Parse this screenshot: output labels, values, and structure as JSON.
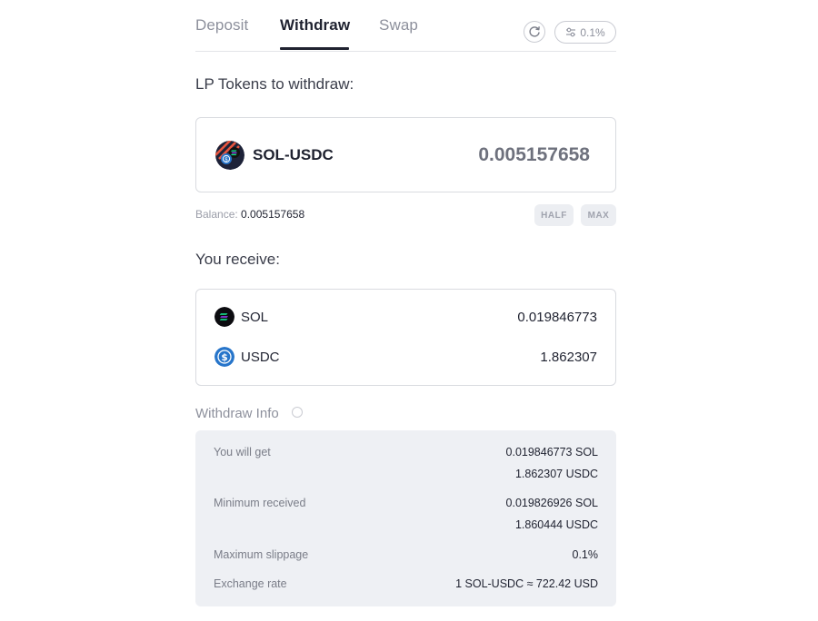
{
  "tabs": [
    {
      "label": "Deposit",
      "active": false
    },
    {
      "label": "Withdraw",
      "active": true
    },
    {
      "label": "Swap",
      "active": false
    }
  ],
  "slippage_button": "0.1%",
  "lp_section_label": "LP Tokens to withdraw:",
  "lp_token": {
    "name": "SOL-USDC",
    "amount": "0.005157658"
  },
  "balance": {
    "label": "Balance:",
    "value": "0.005157658"
  },
  "buttons": {
    "half": "HALF",
    "max": "MAX"
  },
  "receive_label": "You receive:",
  "receive": [
    {
      "token": "SOL",
      "amount": "0.019846773",
      "icon": "sol-icon"
    },
    {
      "token": "USDC",
      "amount": "1.862307",
      "icon": "usdc-icon"
    }
  ],
  "info_title": "Withdraw Info",
  "info": {
    "you_will_get": {
      "label": "You will get",
      "sol": "0.019846773 SOL",
      "usdc": "1.862307 USDC"
    },
    "minimum_received": {
      "label": "Minimum received",
      "sol": "0.019826926 SOL",
      "usdc": "1.860444 USDC"
    },
    "maximum_slippage": {
      "label": "Maximum slippage",
      "value": "0.1%"
    },
    "exchange_rate": {
      "label": "Exchange rate",
      "value": "1 SOL-USDC ≈ 722.42 USD"
    }
  },
  "colors": {
    "sol": "#14f195",
    "usdc": "#2775ca",
    "lp_stripes": "#e8553e"
  }
}
